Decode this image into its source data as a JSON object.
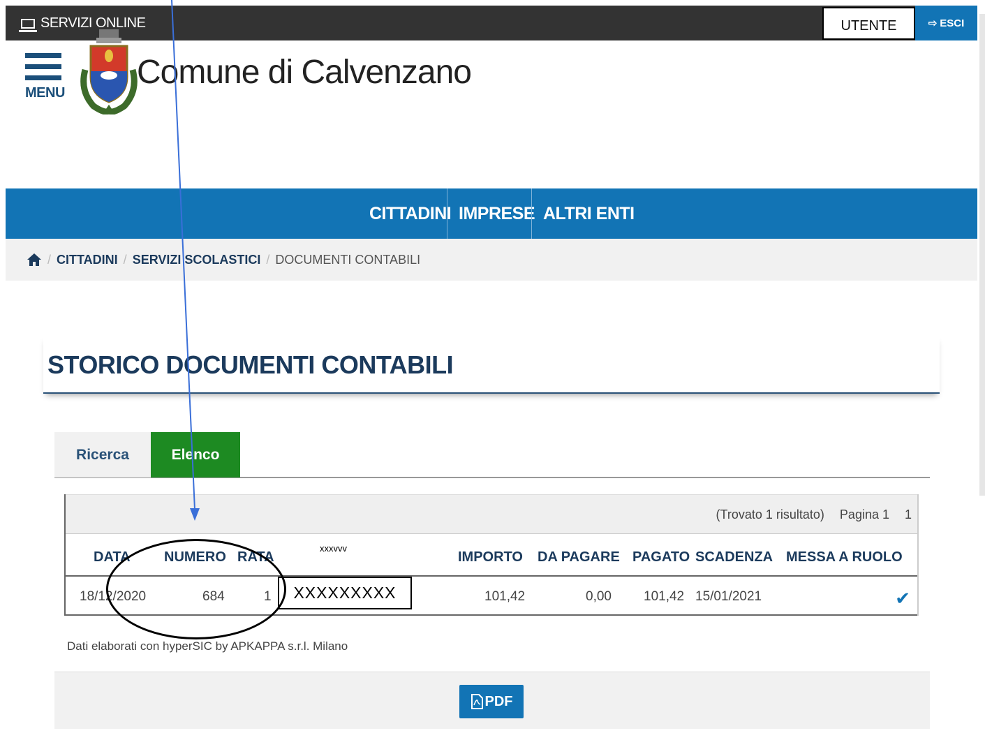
{
  "topbar": {
    "service_label": "SERVIZI ONLINE",
    "user_label": "UTENTE",
    "logout_label": "ESCI"
  },
  "header": {
    "menu_label": "MENU",
    "site_title": "Comune di Calvenzano"
  },
  "nav": {
    "items": [
      "CITTADINI",
      "IMPRESE",
      "ALTRI ENTI"
    ]
  },
  "breadcrumb": {
    "items": [
      "CITTADINI",
      "SERVIZI SCOLASTICI",
      "DOCUMENTI CONTABILI"
    ]
  },
  "page": {
    "title": "STORICO DOCUMENTI CONTABILI"
  },
  "tabs": {
    "ricerca": "Ricerca",
    "elenco": "Elenco"
  },
  "table": {
    "result_text": "(Trovato 1 risultato)",
    "page_label": "Pagina 1",
    "page_total": "1",
    "headers": {
      "data": "DATA",
      "numero": "NUMERO",
      "rata": "RATA",
      "importo": "IMPORTO",
      "da_pagare": "DA PAGARE",
      "pagato": "PAGATO",
      "scadenza": "SCADENZA",
      "messa_a_ruolo": "MESSA A RUOLO"
    },
    "rows": [
      {
        "data": "18/12/2020",
        "numero": "684",
        "rata": "1",
        "importo": "101,42",
        "da_pagare": "0,00",
        "pagato": "101,42",
        "scadenza": "15/01/2021"
      }
    ]
  },
  "overlay": {
    "mask_label": "xxxvvv",
    "mask_value": "XXXXXXXXX"
  },
  "footer": {
    "credit": "Dati elaborati con hyperSIC by APKAPPA s.r.l. Milano",
    "pdf_label": "PDF"
  },
  "colors": {
    "brand_blue": "#1274b5",
    "active_tab_green": "#1d8a22",
    "topbar_dark": "#333333"
  },
  "icons": [
    "computer-icon",
    "logout-icon",
    "hamburger-icon",
    "crest-logo",
    "home-icon",
    "check-icon",
    "pdf-icon"
  ]
}
